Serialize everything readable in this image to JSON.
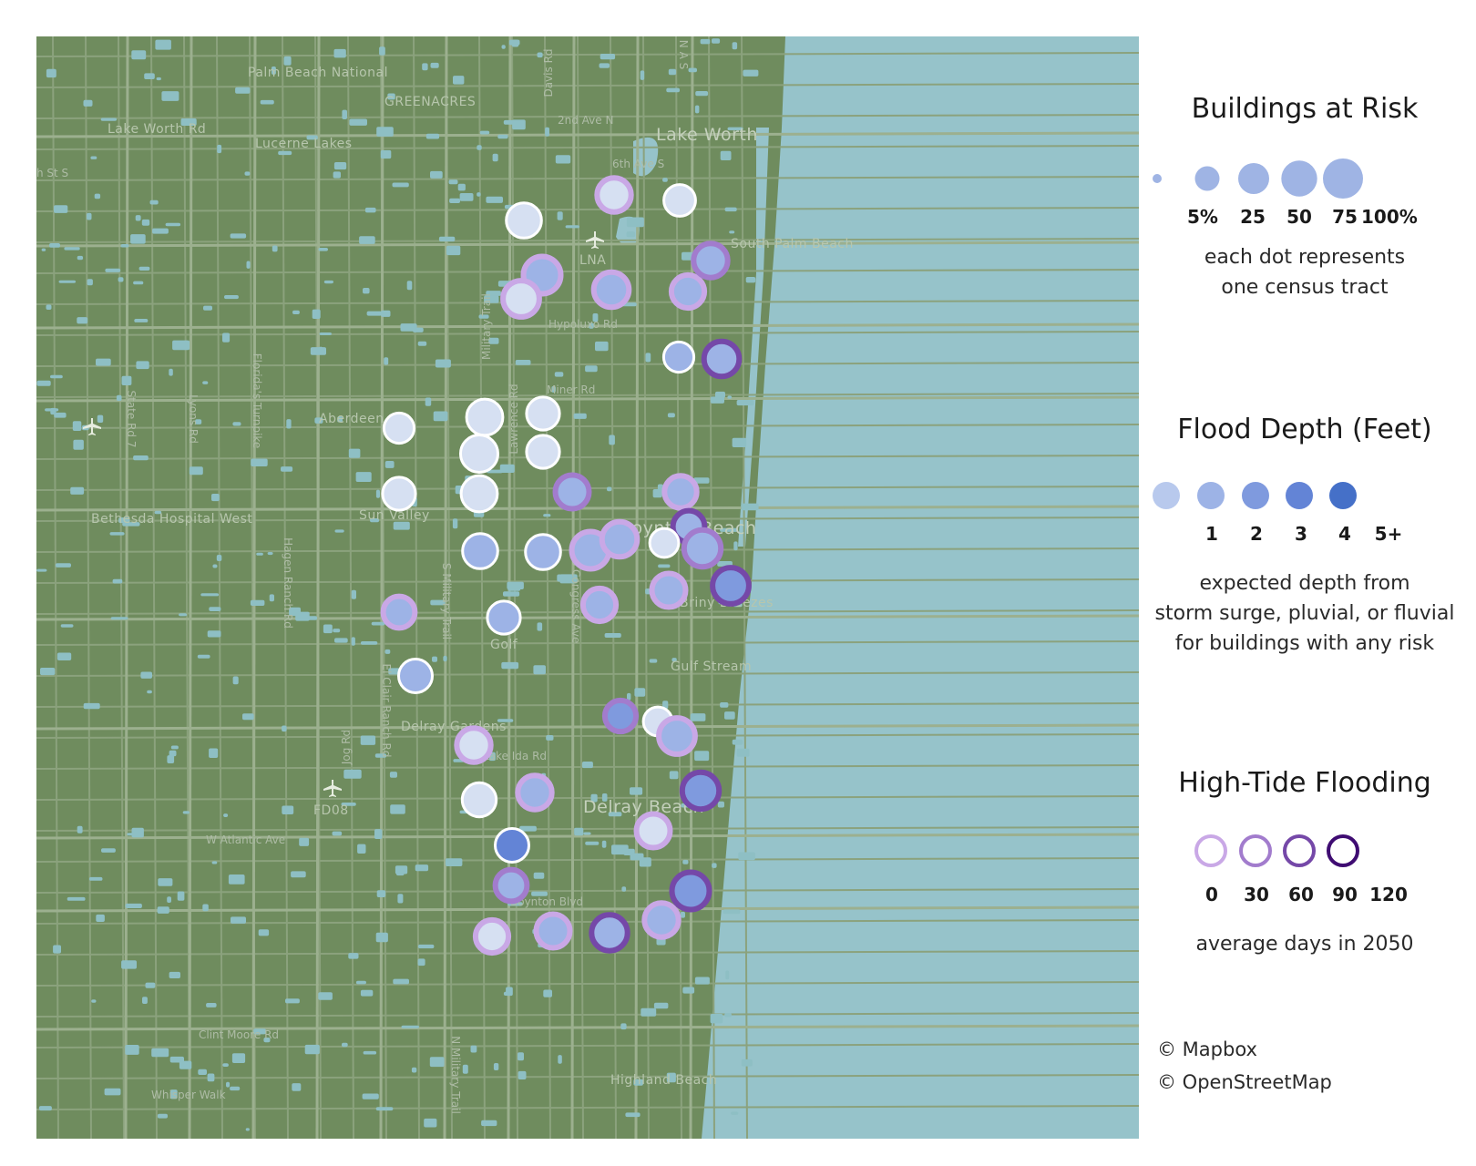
{
  "map": {
    "colors": {
      "land": "#6f8c5e",
      "water": "#96c3ca",
      "road": "#8ba27d"
    },
    "place_labels": [
      "Palm Beach National",
      "GREENACRES",
      "Lake Worth Rd",
      "Lucerne Lakes",
      "2nd Ave N",
      "Lake Worth",
      "6th Ave S",
      "LNA",
      "South Palm Beach",
      "Hypoluxo Rd",
      "Military Trail",
      "Florida's Turnpike",
      "State Rd 7",
      "Lyons Rd",
      "Lawrence Rd",
      "Miner Rd",
      "Aberdeen",
      "Boynton Beach",
      "Sun Valley",
      "Bethesda Hospital West",
      "Hagen Ranch Rd",
      "S Military Trail",
      "S Congress Ave",
      "Briny Breezes",
      "Golf",
      "Gulf Stream",
      "El Clair Ranch Rd",
      "Jog Rd",
      "Delray Gardens",
      "Lake Ida Rd",
      "FD08",
      "W Atlantic Ave",
      "Delray Beach",
      "Boynton Blvd",
      "Clint Moore Rd",
      "N Military Trail",
      "Highland Beach",
      "Whisper Walk",
      "Davis Rd",
      "N A S",
      "h St S"
    ],
    "tracts": [
      {
        "risk": 55,
        "depth": 1,
        "tide": 0
      },
      {
        "risk": 50,
        "depth": 1,
        "tide": 30
      },
      {
        "risk": 40,
        "depth": 1,
        "tide": 0
      },
      {
        "risk": 65,
        "depth": 2,
        "tide": 30
      },
      {
        "risk": 60,
        "depth": 1,
        "tide": 30
      },
      {
        "risk": 55,
        "depth": 2,
        "tide": 30
      },
      {
        "risk": 45,
        "depth": 2,
        "tide": 30
      },
      {
        "risk": 50,
        "depth": 2,
        "tide": 60
      },
      {
        "risk": 35,
        "depth": 2,
        "tide": 0
      },
      {
        "risk": 55,
        "depth": 2,
        "tide": 90
      },
      {
        "risk": 35,
        "depth": 1,
        "tide": 0
      },
      {
        "risk": 60,
        "depth": 1,
        "tide": 0
      },
      {
        "risk": 45,
        "depth": 1,
        "tide": 0
      },
      {
        "risk": 65,
        "depth": 1,
        "tide": 0
      },
      {
        "risk": 45,
        "depth": 1,
        "tide": 0
      },
      {
        "risk": 48,
        "depth": 2,
        "tide": 60
      },
      {
        "risk": 45,
        "depth": 1,
        "tide": 0
      },
      {
        "risk": 60,
        "depth": 1,
        "tide": 0
      },
      {
        "risk": 42,
        "depth": 2,
        "tide": 30
      },
      {
        "risk": 40,
        "depth": 2,
        "tide": 90
      },
      {
        "risk": 55,
        "depth": 2,
        "tide": 0
      },
      {
        "risk": 55,
        "depth": 2,
        "tide": 0
      },
      {
        "risk": 65,
        "depth": 2,
        "tide": 30
      },
      {
        "risk": 55,
        "depth": 2,
        "tide": 30
      },
      {
        "risk": 30,
        "depth": 1,
        "tide": 0
      },
      {
        "risk": 62,
        "depth": 2,
        "tide": 60
      },
      {
        "risk": 60,
        "depth": 3,
        "tide": 90
      },
      {
        "risk": 48,
        "depth": 2,
        "tide": 30
      },
      {
        "risk": 45,
        "depth": 2,
        "tide": 30
      },
      {
        "risk": 40,
        "depth": 2,
        "tide": 30
      },
      {
        "risk": 45,
        "depth": 2,
        "tide": 0
      },
      {
        "risk": 48,
        "depth": 2,
        "tide": 0
      },
      {
        "risk": 38,
        "depth": 3,
        "tide": 60
      },
      {
        "risk": 30,
        "depth": 1,
        "tide": 0
      },
      {
        "risk": 60,
        "depth": 2,
        "tide": 30
      },
      {
        "risk": 50,
        "depth": 1,
        "tide": 30
      },
      {
        "risk": 50,
        "depth": 2,
        "tide": 30
      },
      {
        "risk": 50,
        "depth": 1,
        "tide": 0
      },
      {
        "risk": 62,
        "depth": 3,
        "tide": 90
      },
      {
        "risk": 48,
        "depth": 1,
        "tide": 30
      },
      {
        "risk": 48,
        "depth": 4,
        "tide": 0
      },
      {
        "risk": 40,
        "depth": 2,
        "tide": 60
      },
      {
        "risk": 65,
        "depth": 3,
        "tide": 90
      },
      {
        "risk": 50,
        "depth": 2,
        "tide": 30
      },
      {
        "risk": 45,
        "depth": 1,
        "tide": 30
      },
      {
        "risk": 48,
        "depth": 2,
        "tide": 30
      },
      {
        "risk": 58,
        "depth": 2,
        "tide": 90
      }
    ]
  },
  "legend": {
    "risk": {
      "title": "Buildings at Risk",
      "ticks": [
        "5%",
        "25",
        "50",
        "75",
        "100%"
      ],
      "values": [
        5,
        25,
        50,
        75,
        100
      ],
      "note": "each dot represents\none census tract"
    },
    "depth": {
      "title": "Flood Depth (Feet)",
      "ticks": [
        "1",
        "2",
        "3",
        "4",
        "5+"
      ],
      "colors": [
        "#b8c9ed",
        "#9db3e6",
        "#7f9ade",
        "#6384d6",
        "#4570c8"
      ],
      "light_fill": "#d6e0f2",
      "note": "expected depth from\nstorm surge, pluvial, or fluvial\nfor buildings with any risk"
    },
    "tide": {
      "title": "High-Tide Flooding",
      "ticks": [
        "0",
        "30",
        "60",
        "90",
        "120"
      ],
      "colors": [
        "#ffffff",
        "#c9a8e6",
        "#a27ccd",
        "#7548a8",
        "#3f0c72"
      ],
      "note": "average days in 2050"
    },
    "credits": [
      "© Mapbox",
      "© OpenStreetMap"
    ]
  }
}
